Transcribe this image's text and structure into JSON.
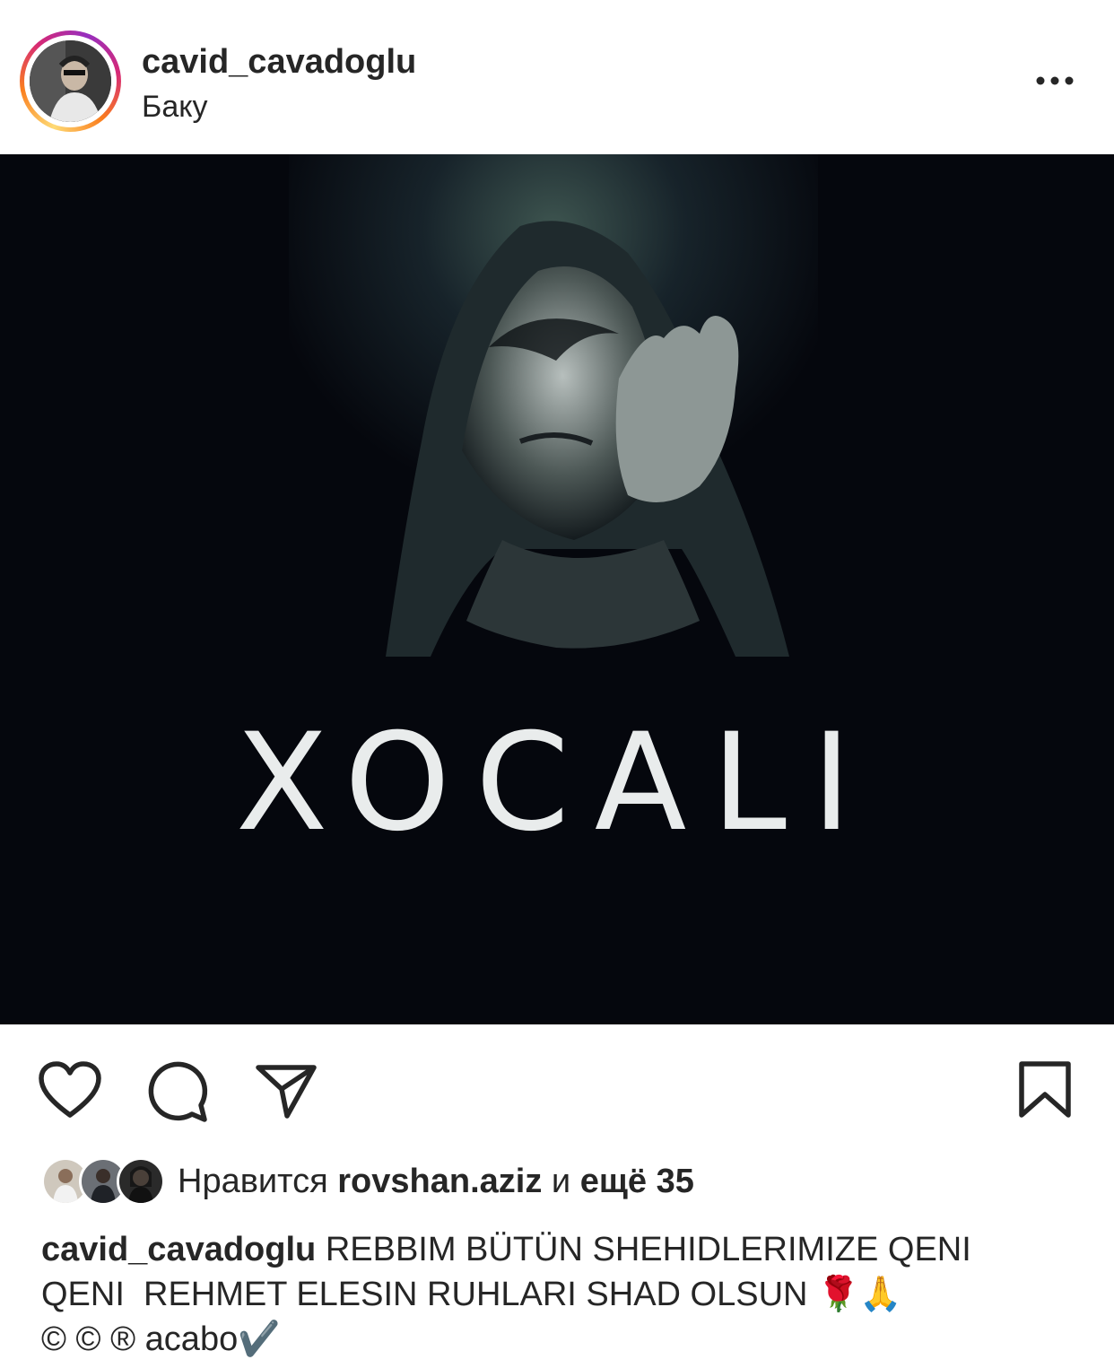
{
  "post": {
    "username": "cavid_cavadoglu",
    "location": "Баку",
    "image_title": "XOCALI",
    "likes": {
      "prefix": "Нравится",
      "liked_by": "rovshan.aziz",
      "joiner": "и",
      "others": "ещё 35"
    },
    "caption": {
      "author": "cavid_cavadoglu",
      "line1": "REBBIM BÜTÜN SHEHIDLERIMIZE QENI",
      "line2": "QENI  REHMET ELESIN RUHLARI SHAD OLSUN 🌹🙏",
      "line3": "© © ® acabo✔️"
    }
  },
  "icons": [
    "more-options-icon",
    "heart-icon",
    "comment-icon",
    "share-icon",
    "bookmark-icon"
  ]
}
